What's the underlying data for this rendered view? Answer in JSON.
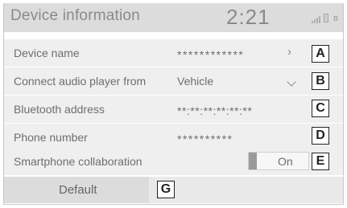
{
  "header": {
    "title": "Device information",
    "clock": "2:21"
  },
  "rows": [
    {
      "label": "Device name",
      "value": "************",
      "callout": "A"
    },
    {
      "label": "Connect audio player from",
      "value": "Vehicle",
      "callout": "B"
    },
    {
      "label": "Bluetooth address",
      "value": "**:**:**:**:**:**",
      "callout": "C"
    },
    {
      "label": "Phone number",
      "value": "**********",
      "callout": "D"
    },
    {
      "label": "Smartphone collaboration",
      "value": "On",
      "callout": "E"
    }
  ],
  "default_button": {
    "label": "Default",
    "callout": "G"
  },
  "icons": {
    "signal": "signal-icon",
    "battery": "battery-icon",
    "bluetooth": "bluetooth-icon",
    "arrow": "chevron-right-icon",
    "dropdown": "chevron-down-icon"
  },
  "colors": {
    "header_bg": "#dcdcdc",
    "row_bg": "#efefef",
    "text": "#6e6e6e",
    "callout_border": "#222222"
  }
}
